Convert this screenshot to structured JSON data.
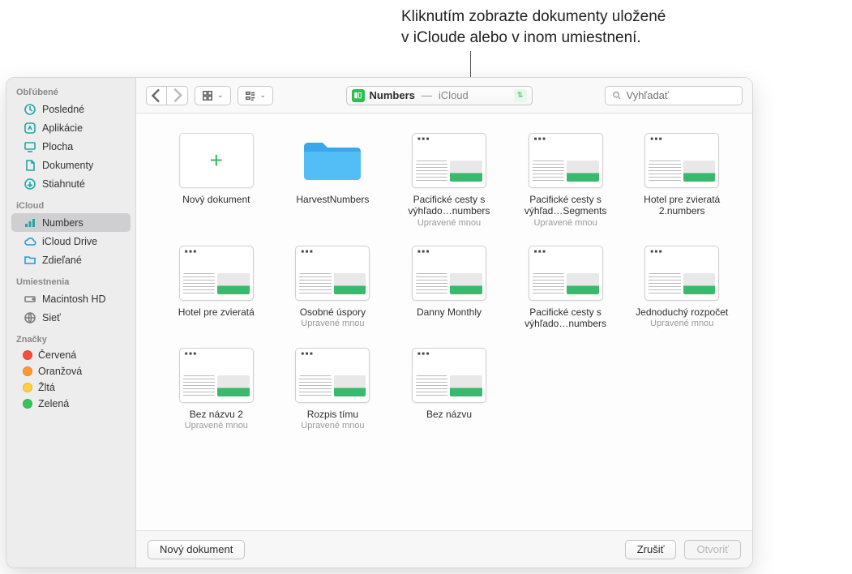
{
  "callout": {
    "line1": "Kliknutím zobrazte dokumenty uložené",
    "line2": "v iCloude alebo v inom umiestnení."
  },
  "sidebar": {
    "sections": [
      {
        "header": "Obľúbené",
        "items": [
          {
            "label": "Posledné",
            "icon": "clock"
          },
          {
            "label": "Aplikácie",
            "icon": "app"
          },
          {
            "label": "Plocha",
            "icon": "desktop"
          },
          {
            "label": "Dokumenty",
            "icon": "doc"
          },
          {
            "label": "Stiahnuté",
            "icon": "download"
          }
        ]
      },
      {
        "header": "iCloud",
        "items": [
          {
            "label": "Numbers",
            "icon": "numbers",
            "selected": true
          },
          {
            "label": "iCloud Drive",
            "icon": "cloud"
          },
          {
            "label": "Zdieľané",
            "icon": "shared"
          }
        ]
      },
      {
        "header": "Umiestnenia",
        "items": [
          {
            "label": "Macintosh HD",
            "icon": "disk"
          },
          {
            "label": "Sieť",
            "icon": "network"
          }
        ]
      },
      {
        "header": "Značky",
        "items": [
          {
            "label": "Červená",
            "tag": "#ff4b3e"
          },
          {
            "label": "Oranžová",
            "tag": "#ff9a2e"
          },
          {
            "label": "Žltá",
            "tag": "#ffcf3e"
          },
          {
            "label": "Zelená",
            "tag": "#35c659"
          }
        ]
      }
    ]
  },
  "toolbar": {
    "location_app": "Numbers",
    "location_sep": " — ",
    "location_sub": "iCloud",
    "search_placeholder": "Vyhľadať"
  },
  "files": [
    {
      "name": "Nový dokument",
      "meta": "",
      "kind": "new"
    },
    {
      "name": "HarvestNumbers",
      "meta": "",
      "kind": "folder"
    },
    {
      "name": "Pacifické cesty s výhľado…numbers",
      "meta": "Upravené mnou",
      "kind": "sheet"
    },
    {
      "name": "Pacifické cesty s výhľad…Segments",
      "meta": "Upravené mnou",
      "kind": "sheet"
    },
    {
      "name": "Hotel pre zvieratá 2.numbers",
      "meta": "",
      "kind": "sheet"
    },
    {
      "name": "Hotel pre zvieratá",
      "meta": "",
      "kind": "sheet"
    },
    {
      "name": "Osobné úspory",
      "meta": "Upravené mnou",
      "kind": "sheet"
    },
    {
      "name": "Danny Monthly",
      "meta": "",
      "kind": "sheet"
    },
    {
      "name": "Pacifické cesty s výhľado…numbers",
      "meta": "",
      "kind": "sheet"
    },
    {
      "name": "Jednoduchý rozpočet",
      "meta": "Upravené mnou",
      "kind": "sheet"
    },
    {
      "name": "Bez názvu 2",
      "meta": "Upravené mnou",
      "kind": "sheet"
    },
    {
      "name": "Rozpis tímu",
      "meta": "Upravené mnou",
      "kind": "sheet"
    },
    {
      "name": "Bez názvu",
      "meta": "",
      "kind": "sheet"
    }
  ],
  "bottombar": {
    "new_doc": "Nový dokument",
    "cancel": "Zrušiť",
    "open": "Otvoriť"
  }
}
